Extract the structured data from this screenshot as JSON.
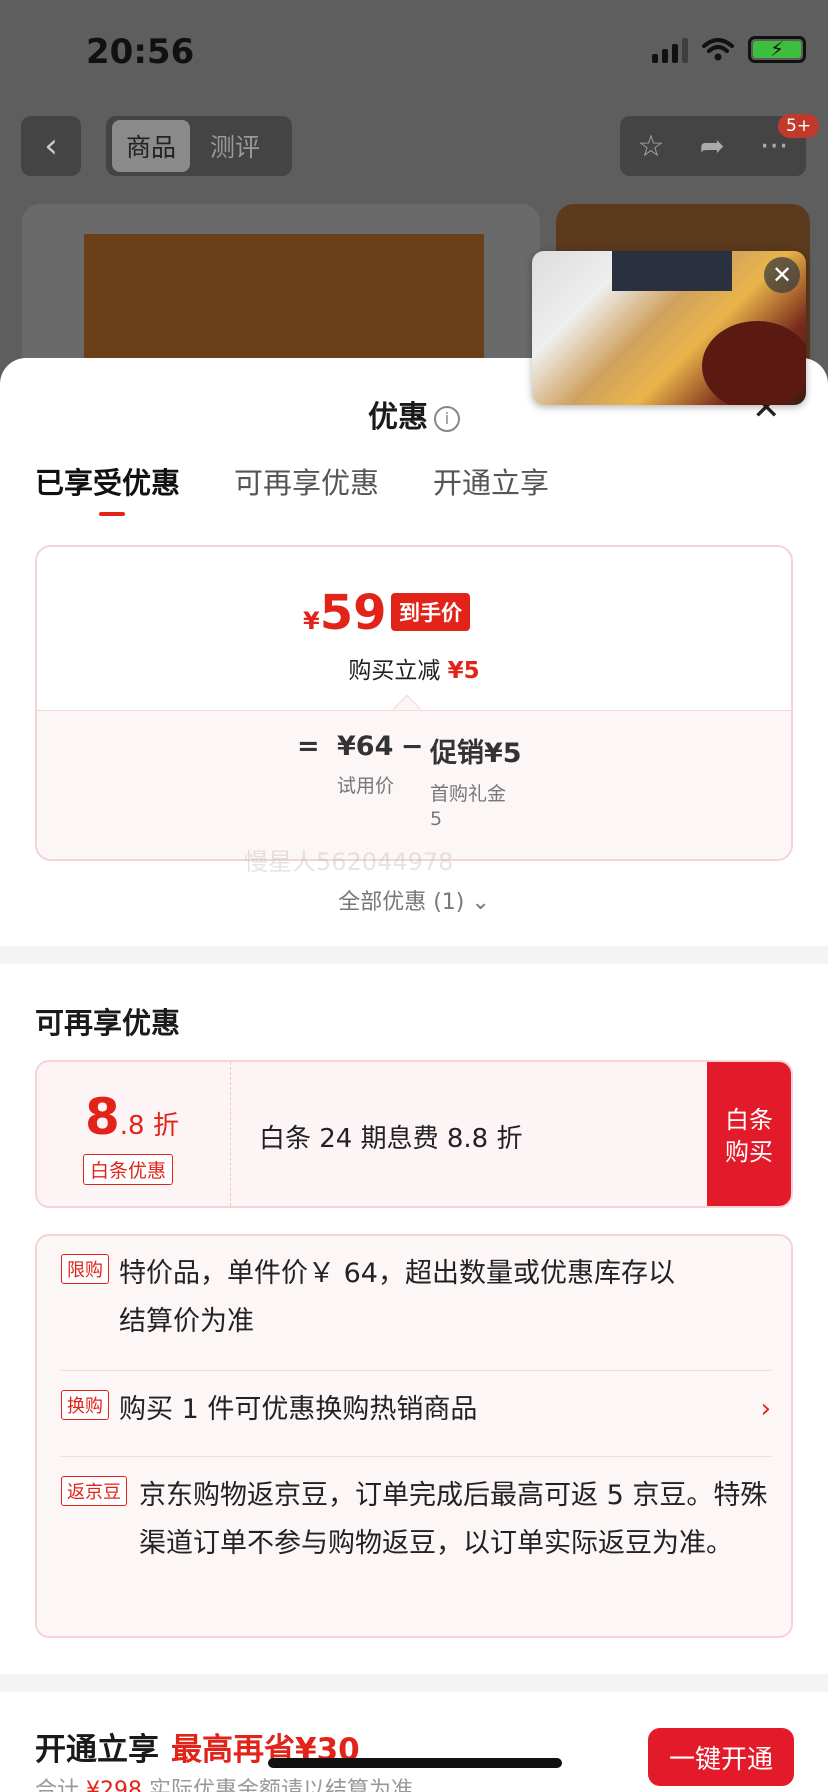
{
  "status_bar": {
    "time": "20:56"
  },
  "top_nav": {
    "tabs": [
      "商品",
      "测评"
    ],
    "badge": "5+"
  },
  "sheet": {
    "title": "优惠",
    "tabs": [
      "已享受优惠",
      "可再享优惠",
      "开通立享"
    ],
    "price_card": {
      "currency": "¥",
      "final_price": "59",
      "final_tag": "到手价",
      "discount_prefix": "购买立减",
      "discount_amount": "¥5",
      "calc_equals": "=",
      "base_price": "¥64",
      "base_label": "试用价",
      "minus": "−",
      "promo_price": "促销¥5",
      "promo_label_1": "首购礼金",
      "promo_label_2": "5"
    },
    "watermark": "慢星人562044978",
    "all_discounts": "全部优惠 (1) ⌄",
    "more_section_title": "可再享优惠",
    "coupon": {
      "rate_int": "8",
      "rate_dec": ".8 折",
      "tag": "白条优惠",
      "desc": "白条 24 期息费 8.8 折",
      "button_line1": "白条",
      "button_line2": "购买"
    },
    "rules": [
      {
        "tag": "限购",
        "text": "特价品，单件价￥ 64，超出数量或优惠库存以结算价为准"
      },
      {
        "tag": "换购",
        "text": "购买 1 件可优惠换购热销商品"
      },
      {
        "tag": "返京豆",
        "text": "京东购物返京豆，订单完成后最高可返 5 京豆。特殊渠道订单不参与购物返豆，以订单实际返豆为准。"
      }
    ],
    "bottom": {
      "title": "开通立享",
      "highlight": "最高再省¥30",
      "sub_prefix": "合计",
      "sub_amount": "¥298",
      "sub_suffix": " 实际优惠金额请以结算为准",
      "button": "一键开通"
    }
  }
}
